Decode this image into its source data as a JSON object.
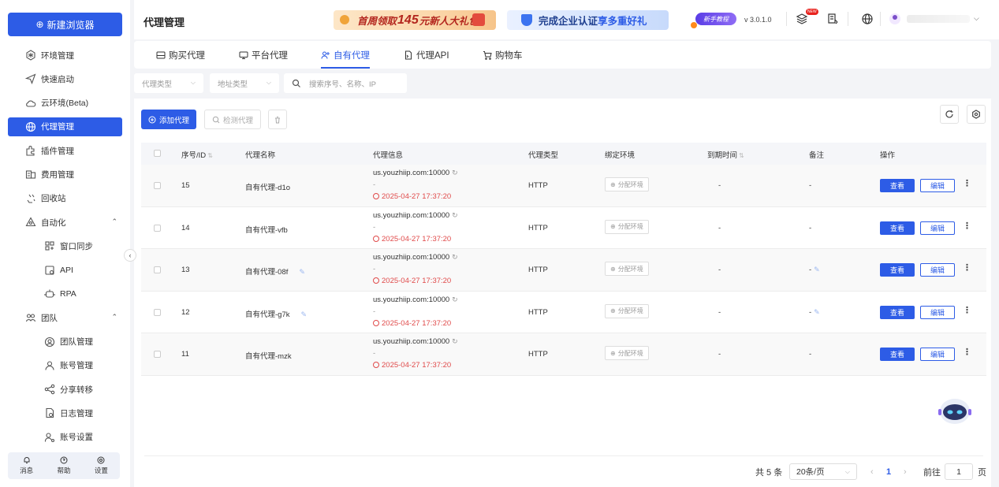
{
  "sidebar": {
    "new_browser": "新建浏览器",
    "items": [
      {
        "label": "环境管理",
        "icon": "env-icon"
      },
      {
        "label": "快速启动",
        "icon": "send-icon"
      },
      {
        "label": "云环境(Beta)",
        "icon": "cloud-icon"
      },
      {
        "label": "代理管理",
        "icon": "globe-icon",
        "active": true
      },
      {
        "label": "插件管理",
        "icon": "plugin-icon"
      },
      {
        "label": "费用管理",
        "icon": "billing-icon"
      },
      {
        "label": "回收站",
        "icon": "recycle-icon"
      },
      {
        "label": "自动化",
        "icon": "automation-icon",
        "expandable": true
      },
      {
        "label": "窗口同步",
        "icon": "sync-icon",
        "sub": true
      },
      {
        "label": "API",
        "icon": "api-icon",
        "sub": true
      },
      {
        "label": "RPA",
        "icon": "robot-icon",
        "sub": true
      },
      {
        "label": "团队",
        "icon": "team-icon",
        "expandable": true
      },
      {
        "label": "团队管理",
        "icon": "team-manage-icon",
        "sub": true
      },
      {
        "label": "账号管理",
        "icon": "user-icon",
        "sub": true
      },
      {
        "label": "分享转移",
        "icon": "share-icon",
        "sub": true
      },
      {
        "label": "日志管理",
        "icon": "log-icon",
        "sub": true
      },
      {
        "label": "账号设置",
        "icon": "user-settings-icon",
        "sub": true
      }
    ],
    "bottom": {
      "messages": "消息",
      "help": "帮助",
      "settings": "设置"
    }
  },
  "header": {
    "title": "代理管理",
    "banner1_pre": "首周领取",
    "banner1_amount": "145",
    "banner1_post": "元新人大礼包",
    "banner2_pre": "完成企业认证",
    "banner2_accent": "享多重好礼",
    "newbie_tag": "新手教程",
    "version": "v 3.0.1.0",
    "new_badge": "NEW"
  },
  "tabs": [
    {
      "label": "购买代理",
      "icon": "card-icon"
    },
    {
      "label": "平台代理",
      "icon": "monitor-icon"
    },
    {
      "label": "自有代理",
      "icon": "users-icon",
      "active": true
    },
    {
      "label": "代理API",
      "icon": "doc-icon"
    },
    {
      "label": "购物车",
      "icon": "cart-icon"
    }
  ],
  "filters": {
    "proxy_type": "代理类型",
    "address_type": "地址类型",
    "search_placeholder": "搜索序号、名称、IP"
  },
  "toolbar": {
    "add": "添加代理",
    "check": "检测代理"
  },
  "table": {
    "columns": [
      "序号/ID",
      "代理名称",
      "代理信息",
      "代理类型",
      "绑定环境",
      "到期时间",
      "备注",
      "操作"
    ],
    "bind_label": "分配环境",
    "view_label": "查看",
    "edit_label": "编辑",
    "rows": [
      {
        "id": "15",
        "name": "自有代理-d1o",
        "host": "us.youzhiip.com:10000",
        "dash": "-",
        "date": "2025-04-27 17:37:20",
        "type": "HTTP",
        "expire": "-",
        "note": "-",
        "editable": false
      },
      {
        "id": "14",
        "name": "自有代理-vfb",
        "host": "us.youzhiip.com:10000",
        "dash": "-",
        "date": "2025-04-27 17:37:20",
        "type": "HTTP",
        "expire": "-",
        "note": "-",
        "editable": false
      },
      {
        "id": "13",
        "name": "自有代理-08f",
        "host": "us.youzhiip.com:10000",
        "dash": "-",
        "date": "2025-04-27 17:37:20",
        "type": "HTTP",
        "expire": "-",
        "note": "-",
        "editable": true
      },
      {
        "id": "12",
        "name": "自有代理-g7k",
        "host": "us.youzhiip.com:10000",
        "dash": "-",
        "date": "2025-04-27 17:37:20",
        "type": "HTTP",
        "expire": "-",
        "note": "-",
        "editable": true
      },
      {
        "id": "11",
        "name": "自有代理-mzk",
        "host": "us.youzhiip.com:10000",
        "dash": "-",
        "date": "2025-04-27 17:37:20",
        "type": "HTTP",
        "expire": "-",
        "note": "-",
        "editable": false
      }
    ]
  },
  "pagination": {
    "total": "共 5 条",
    "page_size": "20条/页",
    "current": "1",
    "goto_label": "前往",
    "goto_value": "1",
    "page_unit": "页"
  },
  "colors": {
    "accent": "#2d5ce6",
    "danger": "#e04a4a"
  }
}
